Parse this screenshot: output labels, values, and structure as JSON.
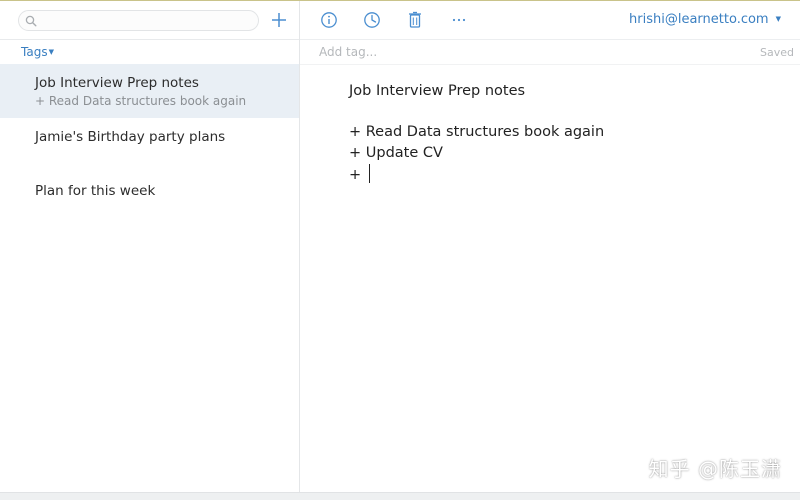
{
  "sidebar": {
    "search": {
      "placeholder": "",
      "value": ""
    },
    "tags_label": "Tags",
    "notes": [
      {
        "title": "Job Interview Prep notes",
        "preview": "+ Read Data structures book again",
        "selected": true
      },
      {
        "title": "Jamie's Birthday party plans",
        "preview": "",
        "selected": false
      },
      {
        "title": "Plan for this week",
        "preview": "",
        "selected": false
      }
    ]
  },
  "toolbar": {
    "account_email": "hrishi@learnetto.com",
    "icons": [
      "info-icon",
      "history-icon",
      "trash-icon",
      "more-icon"
    ]
  },
  "editor": {
    "tag_placeholder": "Add tag...",
    "save_status": "Saved",
    "lines": [
      "Job Interview Prep notes",
      "",
      "+ Read Data structures book again",
      "+ Update CV",
      "+ "
    ]
  },
  "watermark": "知乎 @陈玉潇",
  "colors": {
    "accent": "#3a7fc1",
    "selected_row": "#e9eff5",
    "muted_text": "#8b8f93"
  }
}
